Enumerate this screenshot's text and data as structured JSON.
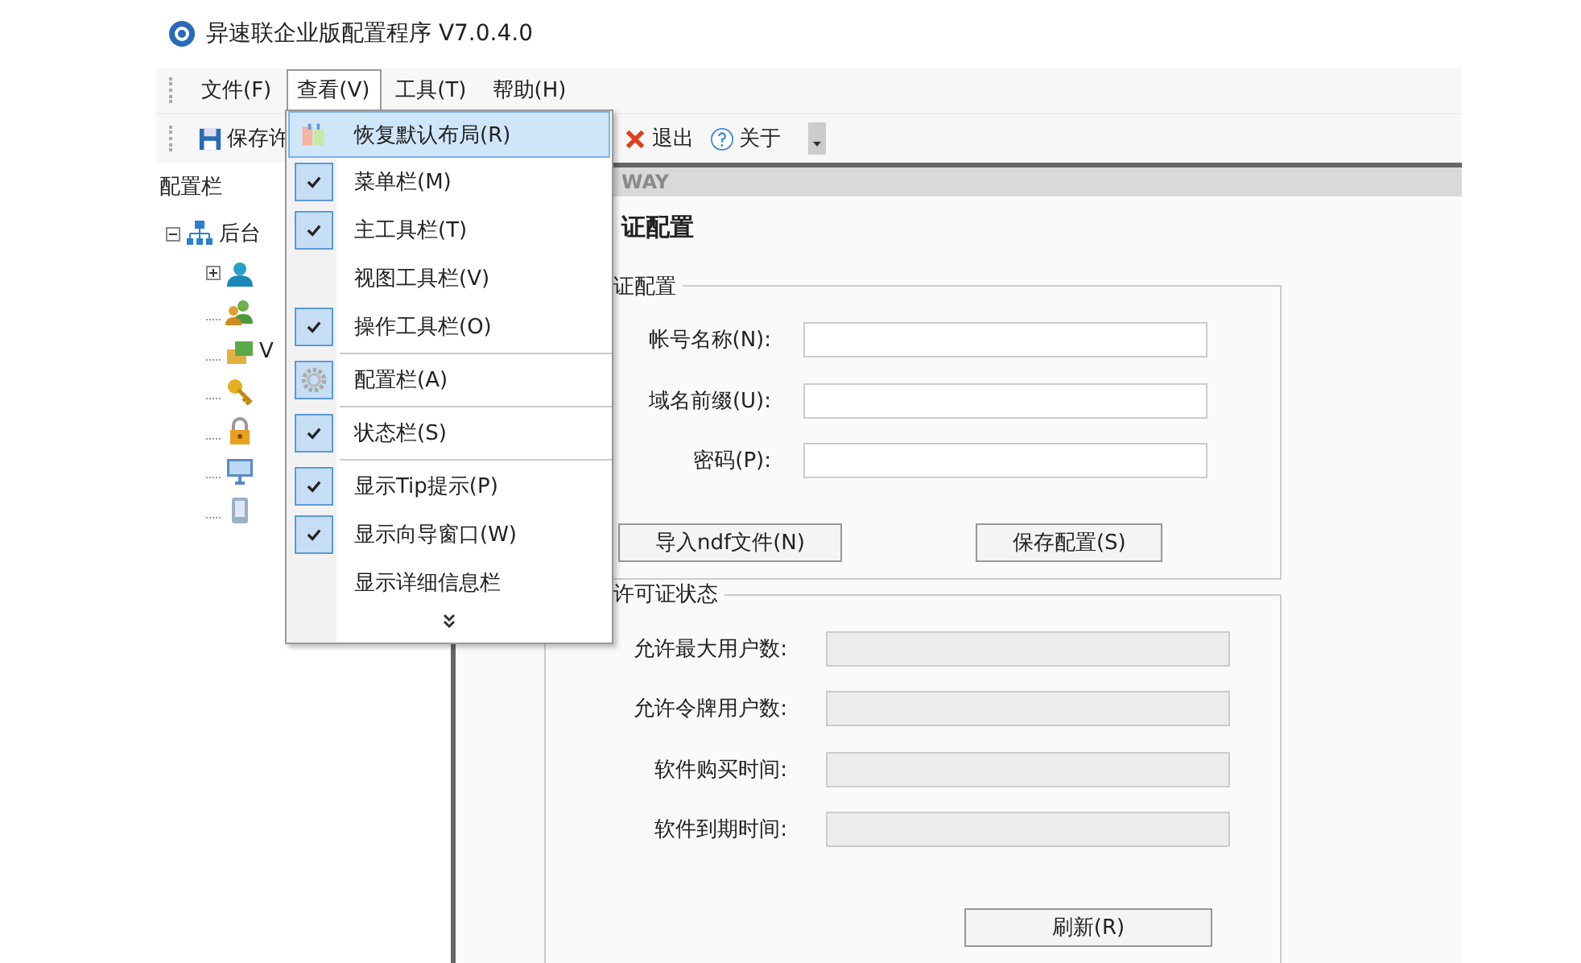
{
  "window": {
    "title": "异速联企业版配置程序 V7.0.4.0"
  },
  "menu_bar": [
    {
      "label": "文件(F)",
      "open": false
    },
    {
      "label": "查看(V)",
      "open": true
    },
    {
      "label": "工具(T)",
      "open": false
    },
    {
      "label": "帮助(H)",
      "open": false
    }
  ],
  "toolbar": [
    {
      "kind": "save",
      "label": "保存许"
    },
    {
      "kind": "exit",
      "label": "退出"
    },
    {
      "kind": "about",
      "label": "关于"
    }
  ],
  "sidebar": {
    "title": "配置栏",
    "tree": [
      {
        "kind": "network",
        "label": "后台",
        "expanded": true,
        "children": [
          {
            "kind": "user",
            "expanded": false
          },
          {
            "kind": "group"
          },
          {
            "kind": "vpn",
            "label": "V"
          },
          {
            "kind": "key"
          },
          {
            "kind": "lock"
          },
          {
            "kind": "monitor"
          },
          {
            "kind": "device"
          }
        ]
      }
    ]
  },
  "content": {
    "header": "WAY",
    "title": "证配置",
    "config_group": {
      "legend": "证配置",
      "fields": [
        {
          "label": "帐号名称(N):"
        },
        {
          "label": "域名前缀(U):"
        },
        {
          "label": "密码(P):"
        }
      ],
      "buttons": [
        "导入ndf文件(N)",
        "保存配置(S)"
      ]
    },
    "status_group": {
      "legend": "许可证状态",
      "fields": [
        {
          "label": "允许最大用户数:",
          "disabled": true
        },
        {
          "label": "允许令牌用户数:",
          "disabled": true
        },
        {
          "label": "软件购买时间:",
          "disabled": true
        },
        {
          "label": "软件到期时间:",
          "disabled": true
        }
      ],
      "buttons": [
        "刷新(R)"
      ]
    }
  },
  "view_menu": [
    {
      "kind": "image",
      "label": "恢复默认布局(R)",
      "selected": true,
      "checked": false
    },
    {
      "kind": "check",
      "label": "菜单栏(M)",
      "selected": false,
      "checked": true
    },
    {
      "kind": "check",
      "label": "主工具栏(T)",
      "selected": false,
      "checked": true
    },
    {
      "kind": "check",
      "label": "视图工具栏(V)",
      "selected": false,
      "checked": false
    },
    {
      "kind": "check",
      "label": "操作工具栏(O)",
      "selected": false,
      "checked": true
    },
    {
      "kind": "separator"
    },
    {
      "kind": "gear",
      "label": "配置栏(A)",
      "selected": false,
      "checked": true
    },
    {
      "kind": "separator"
    },
    {
      "kind": "check",
      "label": "状态栏(S)",
      "selected": false,
      "checked": true
    },
    {
      "kind": "separator"
    },
    {
      "kind": "check",
      "label": "显示Tip提示(P)",
      "selected": false,
      "checked": true
    },
    {
      "kind": "check",
      "label": "显示向导窗口(W)",
      "selected": false,
      "checked": true
    },
    {
      "kind": "check",
      "label": "显示详细信息栏",
      "selected": false,
      "checked": false
    },
    {
      "kind": "more"
    }
  ]
}
